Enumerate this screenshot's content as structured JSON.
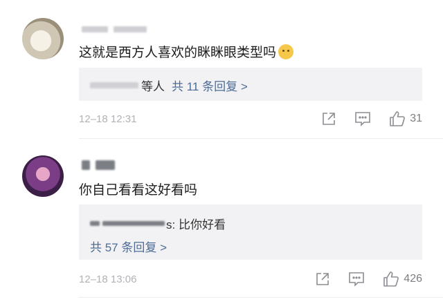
{
  "comments": [
    {
      "text": "这就是西方人喜欢的眯眯眼类型吗",
      "emoji_icon": "worried-face-emoji",
      "reply_prefix": "等人",
      "reply_link": "共 11 条回复 >",
      "time": "12–18 12:31",
      "likes": "31"
    },
    {
      "text": "你自己看看这好看吗",
      "reply_snippet_suffix": "s: 比你好看",
      "reply_link": "共 57 条回复 >",
      "time": "12–18 13:06",
      "likes": "426"
    }
  ],
  "icons": {
    "share": "share-icon",
    "comment": "comment-icon",
    "like": "thumbs-up-icon"
  },
  "colors": {
    "link": "#4c6b96",
    "meta": "#b1b1b6",
    "reply_bg": "#f2f2f4"
  }
}
